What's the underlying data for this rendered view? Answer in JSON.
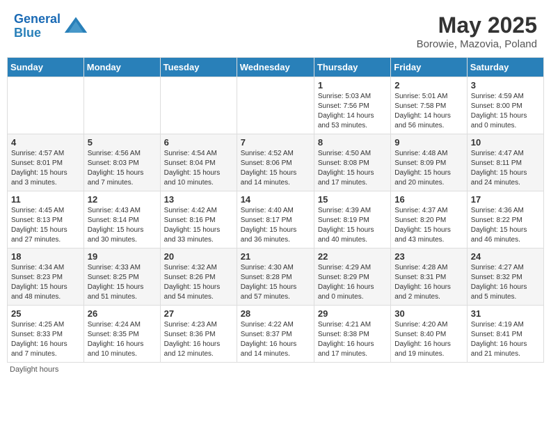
{
  "header": {
    "logo_line1": "General",
    "logo_line2": "Blue",
    "month_year": "May 2025",
    "location": "Borowie, Mazovia, Poland"
  },
  "days_of_week": [
    "Sunday",
    "Monday",
    "Tuesday",
    "Wednesday",
    "Thursday",
    "Friday",
    "Saturday"
  ],
  "weeks": [
    [
      {
        "day": "",
        "info": ""
      },
      {
        "day": "",
        "info": ""
      },
      {
        "day": "",
        "info": ""
      },
      {
        "day": "",
        "info": ""
      },
      {
        "day": "1",
        "info": "Sunrise: 5:03 AM\nSunset: 7:56 PM\nDaylight: 14 hours\nand 53 minutes."
      },
      {
        "day": "2",
        "info": "Sunrise: 5:01 AM\nSunset: 7:58 PM\nDaylight: 14 hours\nand 56 minutes."
      },
      {
        "day": "3",
        "info": "Sunrise: 4:59 AM\nSunset: 8:00 PM\nDaylight: 15 hours\nand 0 minutes."
      }
    ],
    [
      {
        "day": "4",
        "info": "Sunrise: 4:57 AM\nSunset: 8:01 PM\nDaylight: 15 hours\nand 3 minutes."
      },
      {
        "day": "5",
        "info": "Sunrise: 4:56 AM\nSunset: 8:03 PM\nDaylight: 15 hours\nand 7 minutes."
      },
      {
        "day": "6",
        "info": "Sunrise: 4:54 AM\nSunset: 8:04 PM\nDaylight: 15 hours\nand 10 minutes."
      },
      {
        "day": "7",
        "info": "Sunrise: 4:52 AM\nSunset: 8:06 PM\nDaylight: 15 hours\nand 14 minutes."
      },
      {
        "day": "8",
        "info": "Sunrise: 4:50 AM\nSunset: 8:08 PM\nDaylight: 15 hours\nand 17 minutes."
      },
      {
        "day": "9",
        "info": "Sunrise: 4:48 AM\nSunset: 8:09 PM\nDaylight: 15 hours\nand 20 minutes."
      },
      {
        "day": "10",
        "info": "Sunrise: 4:47 AM\nSunset: 8:11 PM\nDaylight: 15 hours\nand 24 minutes."
      }
    ],
    [
      {
        "day": "11",
        "info": "Sunrise: 4:45 AM\nSunset: 8:13 PM\nDaylight: 15 hours\nand 27 minutes."
      },
      {
        "day": "12",
        "info": "Sunrise: 4:43 AM\nSunset: 8:14 PM\nDaylight: 15 hours\nand 30 minutes."
      },
      {
        "day": "13",
        "info": "Sunrise: 4:42 AM\nSunset: 8:16 PM\nDaylight: 15 hours\nand 33 minutes."
      },
      {
        "day": "14",
        "info": "Sunrise: 4:40 AM\nSunset: 8:17 PM\nDaylight: 15 hours\nand 36 minutes."
      },
      {
        "day": "15",
        "info": "Sunrise: 4:39 AM\nSunset: 8:19 PM\nDaylight: 15 hours\nand 40 minutes."
      },
      {
        "day": "16",
        "info": "Sunrise: 4:37 AM\nSunset: 8:20 PM\nDaylight: 15 hours\nand 43 minutes."
      },
      {
        "day": "17",
        "info": "Sunrise: 4:36 AM\nSunset: 8:22 PM\nDaylight: 15 hours\nand 46 minutes."
      }
    ],
    [
      {
        "day": "18",
        "info": "Sunrise: 4:34 AM\nSunset: 8:23 PM\nDaylight: 15 hours\nand 48 minutes."
      },
      {
        "day": "19",
        "info": "Sunrise: 4:33 AM\nSunset: 8:25 PM\nDaylight: 15 hours\nand 51 minutes."
      },
      {
        "day": "20",
        "info": "Sunrise: 4:32 AM\nSunset: 8:26 PM\nDaylight: 15 hours\nand 54 minutes."
      },
      {
        "day": "21",
        "info": "Sunrise: 4:30 AM\nSunset: 8:28 PM\nDaylight: 15 hours\nand 57 minutes."
      },
      {
        "day": "22",
        "info": "Sunrise: 4:29 AM\nSunset: 8:29 PM\nDaylight: 16 hours\nand 0 minutes."
      },
      {
        "day": "23",
        "info": "Sunrise: 4:28 AM\nSunset: 8:31 PM\nDaylight: 16 hours\nand 2 minutes."
      },
      {
        "day": "24",
        "info": "Sunrise: 4:27 AM\nSunset: 8:32 PM\nDaylight: 16 hours\nand 5 minutes."
      }
    ],
    [
      {
        "day": "25",
        "info": "Sunrise: 4:25 AM\nSunset: 8:33 PM\nDaylight: 16 hours\nand 7 minutes."
      },
      {
        "day": "26",
        "info": "Sunrise: 4:24 AM\nSunset: 8:35 PM\nDaylight: 16 hours\nand 10 minutes."
      },
      {
        "day": "27",
        "info": "Sunrise: 4:23 AM\nSunset: 8:36 PM\nDaylight: 16 hours\nand 12 minutes."
      },
      {
        "day": "28",
        "info": "Sunrise: 4:22 AM\nSunset: 8:37 PM\nDaylight: 16 hours\nand 14 minutes."
      },
      {
        "day": "29",
        "info": "Sunrise: 4:21 AM\nSunset: 8:38 PM\nDaylight: 16 hours\nand 17 minutes."
      },
      {
        "day": "30",
        "info": "Sunrise: 4:20 AM\nSunset: 8:40 PM\nDaylight: 16 hours\nand 19 minutes."
      },
      {
        "day": "31",
        "info": "Sunrise: 4:19 AM\nSunset: 8:41 PM\nDaylight: 16 hours\nand 21 minutes."
      }
    ]
  ],
  "footer": {
    "note": "Daylight hours"
  }
}
